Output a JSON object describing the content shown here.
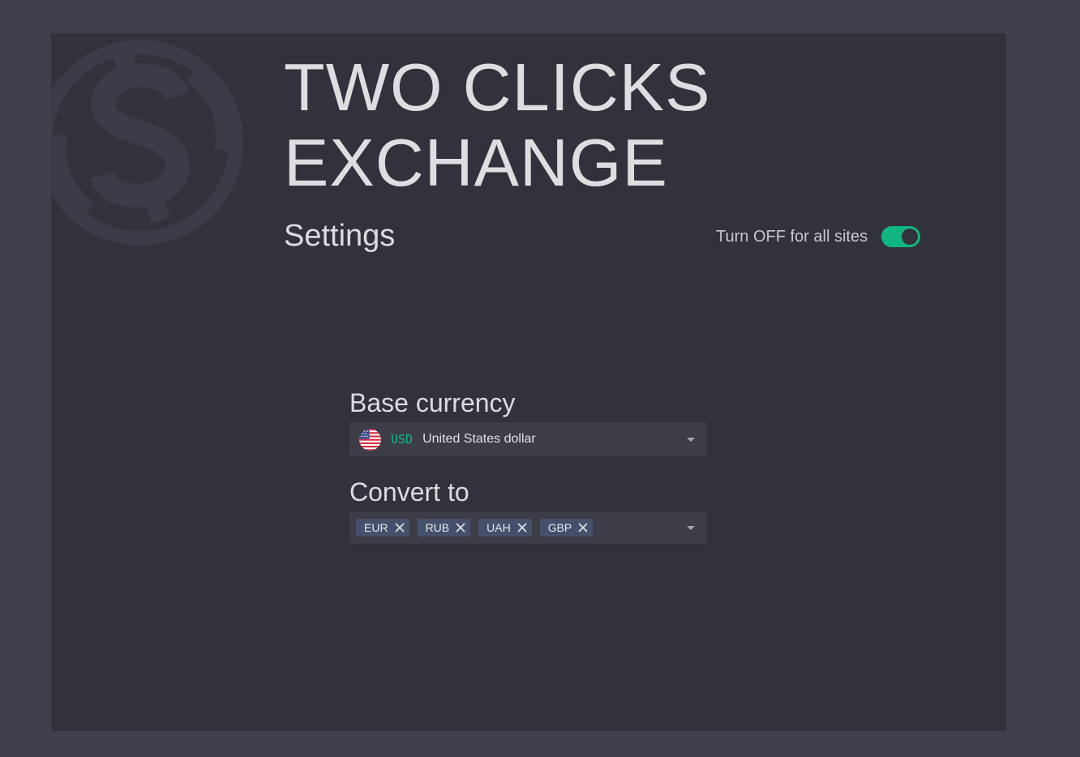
{
  "app": {
    "title_line1": "TWO CLICKS",
    "title_line2": "EXCHANGE",
    "logo_icon": "dollar-coin-icon"
  },
  "settings": {
    "heading": "Settings",
    "toggle_label": "Turn OFF for all sites",
    "toggle_on": true,
    "toggle_color": "#10b67e"
  },
  "base_currency": {
    "label": "Base currency",
    "selected": {
      "code": "USD",
      "name": "United States dollar",
      "flag_icon": "us-flag-icon"
    }
  },
  "convert_to": {
    "label": "Convert to",
    "tags": [
      {
        "code": "EUR"
      },
      {
        "code": "RUB"
      },
      {
        "code": "UAH"
      },
      {
        "code": "GBP"
      }
    ]
  },
  "colors": {
    "accent": "#14b884",
    "background": "#40404c",
    "panel": "#32323c",
    "tag": "#46506a"
  }
}
